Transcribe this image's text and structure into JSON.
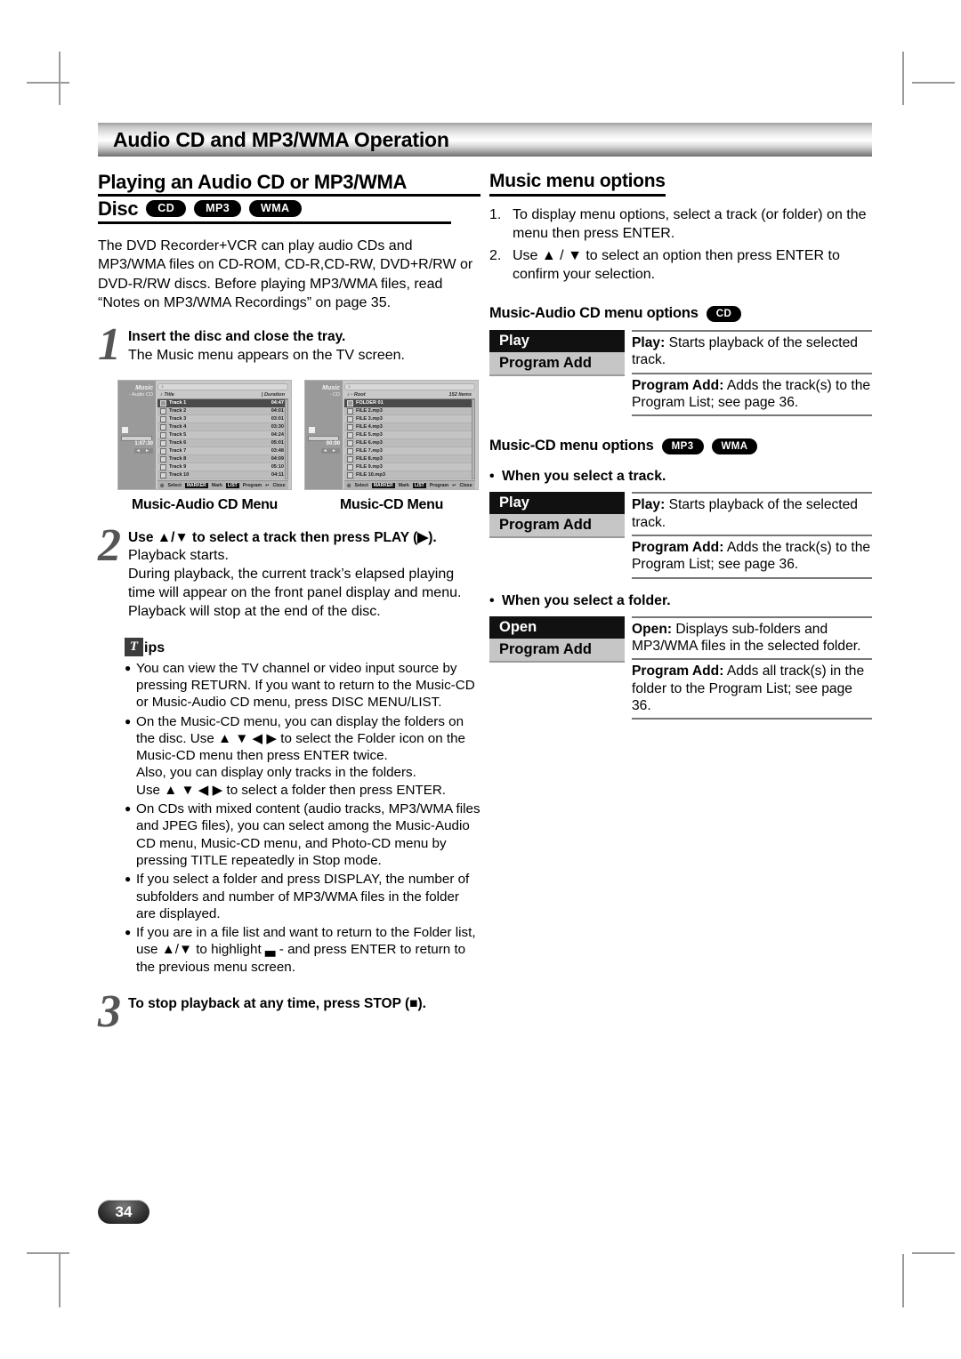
{
  "page": {
    "number": "34",
    "banner_title": "Audio CD and MP3/WMA Operation"
  },
  "left": {
    "heading_line1": "Playing an Audio CD or MP3/WMA",
    "heading_line2": "Disc",
    "disc_badges": [
      "CD",
      "MP3",
      "WMA"
    ],
    "intro": "The DVD Recorder+VCR can play audio CDs and MP3/WMA files on CD-ROM, CD-R,CD-RW, DVD+R/RW or DVD-R/RW discs. Before playing MP3/WMA files, read “Notes on MP3/WMA Recordings” on page 35.",
    "steps": [
      {
        "num": "1",
        "title": "Insert the disc and close the tray.",
        "body": "The Music menu appears on the TV screen."
      },
      {
        "num": "2",
        "title": "Use ▲/▼ to select a track then press PLAY (▶).",
        "body": "Playback starts.",
        "body2": "During playback, the current track’s elapsed playing time will appear on the front panel display and menu. Playback will stop at the end of the disc."
      },
      {
        "num": "3",
        "title": "To stop playback at any time, press STOP (■)."
      }
    ],
    "captions": [
      "Music-Audio CD Menu",
      "Music-CD Menu"
    ],
    "tips": {
      "box_letter": "T",
      "word": "ips",
      "items": [
        "You can view the TV channel or video input source by pressing RETURN. If you want to return to the Music-CD or Music-Audio CD menu, press DISC MENU/LIST.",
        "On the Music-CD menu, you can display the folders on the disc. Use ▲ ▼ ◀ ▶ to select the Folder icon on the Music-CD menu then press ENTER twice.\nAlso, you can display only tracks in the folders.\nUse ▲ ▼ ◀ ▶ to select a folder then press ENTER.",
        "On CDs with mixed content (audio tracks, MP3/WMA files and JPEG files), you can select among the Music-Audio CD menu, Music-CD menu, and Photo-CD menu by pressing TITLE repeatedly in Stop mode.",
        "If you select a folder and press DISPLAY, the number of subfolders and number of MP3/WMA files in the folder are displayed.",
        "If you are in a file list and want to return to the Folder list, use ▲/▼ to highlight ▃ - and press ENTER to return to the previous menu screen."
      ]
    }
  },
  "screens": {
    "audio_cd": {
      "side_title": "Music",
      "side_sub": "- Audio CD",
      "time": "1:07:30",
      "col_title": "Title",
      "col_duration": "Duration",
      "rows": [
        {
          "name": "Track 1",
          "dur": "04:47"
        },
        {
          "name": "Track 2",
          "dur": "04:01"
        },
        {
          "name": "Track 3",
          "dur": "03:01"
        },
        {
          "name": "Track 4",
          "dur": "03:30"
        },
        {
          "name": "Track 5",
          "dur": "04:24"
        },
        {
          "name": "Track 6",
          "dur": "05:01"
        },
        {
          "name": "Track 7",
          "dur": "03:48"
        },
        {
          "name": "Track 8",
          "dur": "04:09"
        },
        {
          "name": "Track 9",
          "dur": "05:10"
        },
        {
          "name": "Track 10",
          "dur": "04:11"
        }
      ],
      "footer": {
        "select": "Select",
        "marker_key": "MARKER",
        "mark": "Mark",
        "list_key": "LIST",
        "program": "Program",
        "close": "Close"
      }
    },
    "cd": {
      "side_title": "Music",
      "side_sub": "- CD",
      "time": "00:00",
      "col_root": "Root",
      "col_items": "152 Items",
      "rows": [
        {
          "name": "FOLDER 01"
        },
        {
          "name": "FILE 2.mp3"
        },
        {
          "name": "FILE 3.mp3"
        },
        {
          "name": "FILE 4.mp3"
        },
        {
          "name": "FILE 5.mp3"
        },
        {
          "name": "FILE 6.mp3"
        },
        {
          "name": "FILE 7.mp3"
        },
        {
          "name": "FILE 8.mp3"
        },
        {
          "name": "FILE 9.mp3"
        },
        {
          "name": "FILE 10.mp3"
        }
      ],
      "footer": {
        "select": "Select",
        "marker_key": "MARKER",
        "mark": "Mark",
        "list_key": "LIST",
        "program": "Program",
        "close": "Close"
      }
    }
  },
  "right": {
    "heading": "Music menu options",
    "steps": [
      {
        "n": "1.",
        "t": "To display menu options, select a track (or folder) on the menu then press ENTER."
      },
      {
        "n": "2.",
        "t": "Use ▲ / ▼ to select an option then press ENTER to confirm your selection."
      }
    ],
    "section_audio": {
      "title": "Music-Audio CD menu options",
      "badges": [
        "CD"
      ],
      "key1": "Play",
      "key2": "Program Add",
      "def1": "Play: Starts playback of the selected track.",
      "def1_bold": "Play:",
      "def2": "Program Add: Adds the track(s) to the Program List; see page 36.",
      "def2_bold": "Program Add:"
    },
    "section_cd": {
      "title": "Music-CD menu options",
      "badges": [
        "MP3",
        "WMA"
      ],
      "track_bullet": "When you select a track.",
      "folder_bullet": "When you select a folder.",
      "track_key1": "Play",
      "track_key2": "Program Add",
      "track_def1_bold": "Play:",
      "track_def1": "Play: Starts playback of the selected track.",
      "track_def2_bold": "Program Add:",
      "track_def2": "Program Add: Adds the track(s) to the Program List; see page 36.",
      "folder_key1": "Open",
      "folder_key2": "Program Add",
      "folder_def1_bold": "Open:",
      "folder_def1": "Open: Displays sub-folders and MP3/WMA files in the selected folder.",
      "folder_def2_bold": "Program Add:",
      "folder_def2": "Program Add: Adds all track(s) in the folder to the Program List; see page 36."
    }
  }
}
